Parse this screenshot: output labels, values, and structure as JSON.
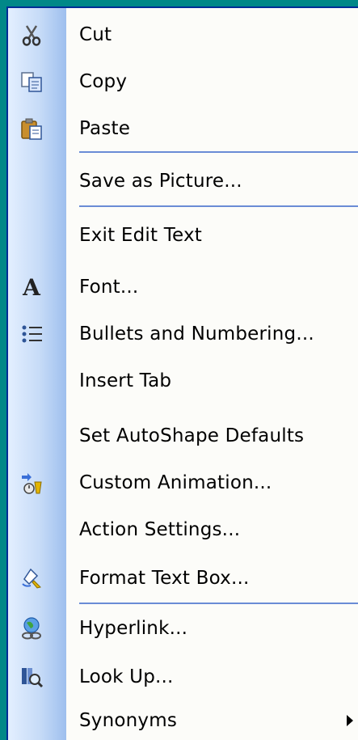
{
  "menu": {
    "items": [
      {
        "id": "cut",
        "label": "Cut",
        "icon": "scissors-icon"
      },
      {
        "id": "copy",
        "label": "Copy",
        "icon": "copy-icon"
      },
      {
        "id": "paste",
        "label": "Paste",
        "icon": "paste-icon"
      },
      {
        "id": "save-as-picture",
        "label": "Save as Picture...",
        "icon": ""
      },
      {
        "id": "exit-edit-text",
        "label": "Exit Edit Text",
        "icon": ""
      },
      {
        "id": "font",
        "label": "Font...",
        "icon": "font-icon"
      },
      {
        "id": "bullets-and-numbering",
        "label": "Bullets and Numbering...",
        "icon": "bullets-icon"
      },
      {
        "id": "insert-tab",
        "label": "Insert Tab",
        "icon": ""
      },
      {
        "id": "set-autoshape-defaults",
        "label": "Set AutoShape Defaults",
        "icon": ""
      },
      {
        "id": "custom-animation",
        "label": "Custom Animation...",
        "icon": "animation-icon"
      },
      {
        "id": "action-settings",
        "label": "Action Settings...",
        "icon": ""
      },
      {
        "id": "format-text-box",
        "label": "Format Text Box...",
        "icon": "format-icon"
      },
      {
        "id": "hyperlink",
        "label": "Hyperlink...",
        "icon": "hyperlink-icon"
      },
      {
        "id": "look-up",
        "label": "Look Up...",
        "icon": "lookup-icon"
      },
      {
        "id": "synonyms",
        "label": "Synonyms",
        "icon": ""
      }
    ],
    "font_icon_glyph": "A",
    "colors": {
      "background": "#018888",
      "menu_bg": "#fcfcf9",
      "gutter": "#c6dbf7",
      "separator": "#6a8cd6",
      "border": "#002d96"
    }
  }
}
